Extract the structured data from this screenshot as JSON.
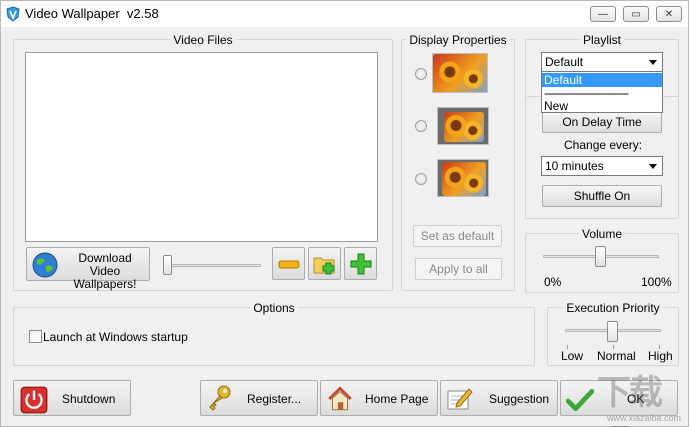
{
  "window": {
    "title": "Video Wallpaper",
    "version": "v2.58",
    "minimize": "—",
    "maximize": "▭",
    "close": "✕"
  },
  "video_files": {
    "title": "Video Files",
    "download_label_line1": "Download Video",
    "download_label_line2": "Wallpapers!",
    "slider_value": 0
  },
  "display_properties": {
    "title": "Display Properties",
    "set_default": "Set as default",
    "apply_all": "Apply to all"
  },
  "playlist": {
    "title": "Playlist",
    "selected": "Default",
    "options": [
      "Default",
      "----------------------------",
      "New"
    ],
    "on_delay": "On Delay Time",
    "change_every_label": "Change every:",
    "interval": "10 minutes",
    "shuffle": "Shuffle On"
  },
  "volume": {
    "title": "Volume",
    "min_label": "0%",
    "max_label": "100%",
    "level": 0.5
  },
  "options": {
    "title": "Options",
    "launch_startup": "Launch at Windows startup",
    "launch_checked": false
  },
  "priority": {
    "title": "Execution Priority",
    "low": "Low",
    "normal": "Normal",
    "high": "High",
    "level": 0.5
  },
  "buttons": {
    "shutdown": "Shutdown",
    "register": "Register...",
    "home_page": "Home Page",
    "suggestion": "Suggestion",
    "ok": "OK"
  },
  "watermark": {
    "text": "下载吧",
    "sub": "www.xiazaiba.com"
  }
}
